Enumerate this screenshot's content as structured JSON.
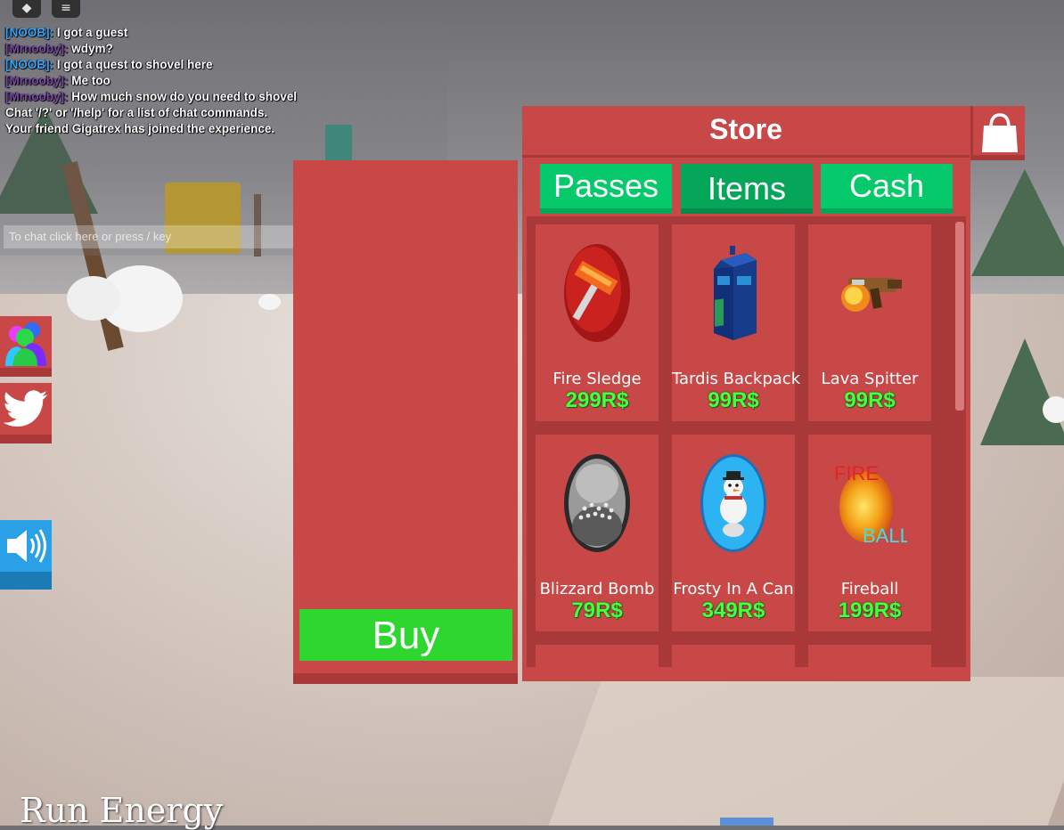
{
  "chat": {
    "lines": [
      {
        "name": "[NOOB]:",
        "name_color": "blue",
        "text": "I got a guest"
      },
      {
        "name": "[Mrnooby]:",
        "name_color": "purple",
        "text": "wdym?"
      },
      {
        "name": "[NOOB]:",
        "name_color": "blue",
        "text": "I got a quest to shovel here"
      },
      {
        "name": "[Mrnooby]:",
        "name_color": "purple",
        "text": "Me too"
      },
      {
        "name": "[Mrnooby]:",
        "name_color": "purple",
        "text": "How much snow do you need to shovel"
      }
    ],
    "system_1": "Chat '/?' or '/help' for a list of chat commands.",
    "system_2": "Your friend Gigatrex has joined the experience.",
    "input_placeholder": "To chat click here or press / key"
  },
  "store": {
    "title": "Store",
    "tabs": [
      {
        "label": "Passes"
      },
      {
        "label": "Items"
      },
      {
        "label": "Cash"
      }
    ],
    "active_tab": "Items",
    "items": [
      {
        "name": "Fire Sledge",
        "price": "299R$",
        "icon": "fire-sledge-icon"
      },
      {
        "name": "Tardis Backpack",
        "price": "99R$",
        "icon": "tardis-backpack-icon"
      },
      {
        "name": "Lava Spitter",
        "price": "99R$",
        "icon": "lava-spitter-icon"
      },
      {
        "name": "Blizzard Bomb",
        "price": "79R$",
        "icon": "blizzard-bomb-icon"
      },
      {
        "name": "Frosty In A Can",
        "price": "349R$",
        "icon": "frosty-can-icon"
      },
      {
        "name": "Fireball",
        "price": "199R$",
        "icon": "fireball-icon"
      }
    ]
  },
  "detail": {
    "buy_label": "Buy"
  },
  "fireball_text": {
    "top": "FIRE",
    "bottom": "BALL"
  },
  "hud": {
    "run_energy": "Run Energy"
  },
  "colors": {
    "panel_red": "#c84848",
    "panel_dark_red": "#a93838",
    "tab_green": "#05c96b",
    "tab_active_green": "#05a55a",
    "buy_green": "#2fd62f",
    "price_green": "#47ff3b"
  }
}
